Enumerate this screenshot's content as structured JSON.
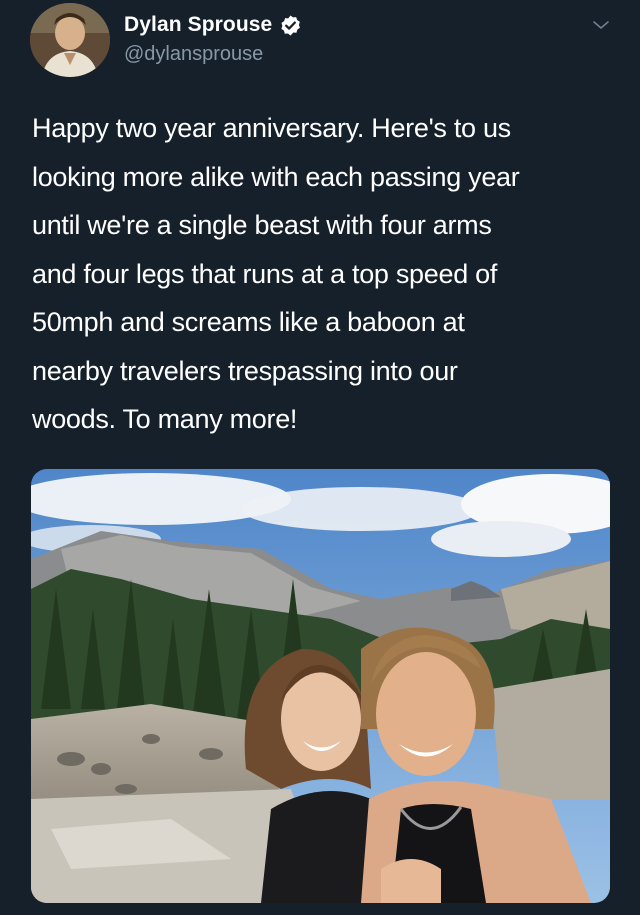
{
  "author": {
    "name": "Dylan Sprouse",
    "handle": "@dylansprouse",
    "verified": true,
    "avatar_icon": "profile-photo-avatar"
  },
  "menu_icon": "chevron-down-icon",
  "tweet": {
    "lines": [
      "Happy two year anniversary. Here's to us",
      "looking more alike with each passing year",
      "until we're a single beast with four arms",
      "and four legs that runs at a top speed of",
      "50mph and screams like a baboon at",
      "nearby travelers trespassing into our",
      "woods. To many more!"
    ]
  },
  "media": {
    "kind": "photo",
    "icon": "selfie-mountain-photo"
  },
  "colors": {
    "background": "#15202b",
    "text": "#ffffff",
    "secondary_text": "#8899a6",
    "verified_badge": "#ffffff"
  }
}
